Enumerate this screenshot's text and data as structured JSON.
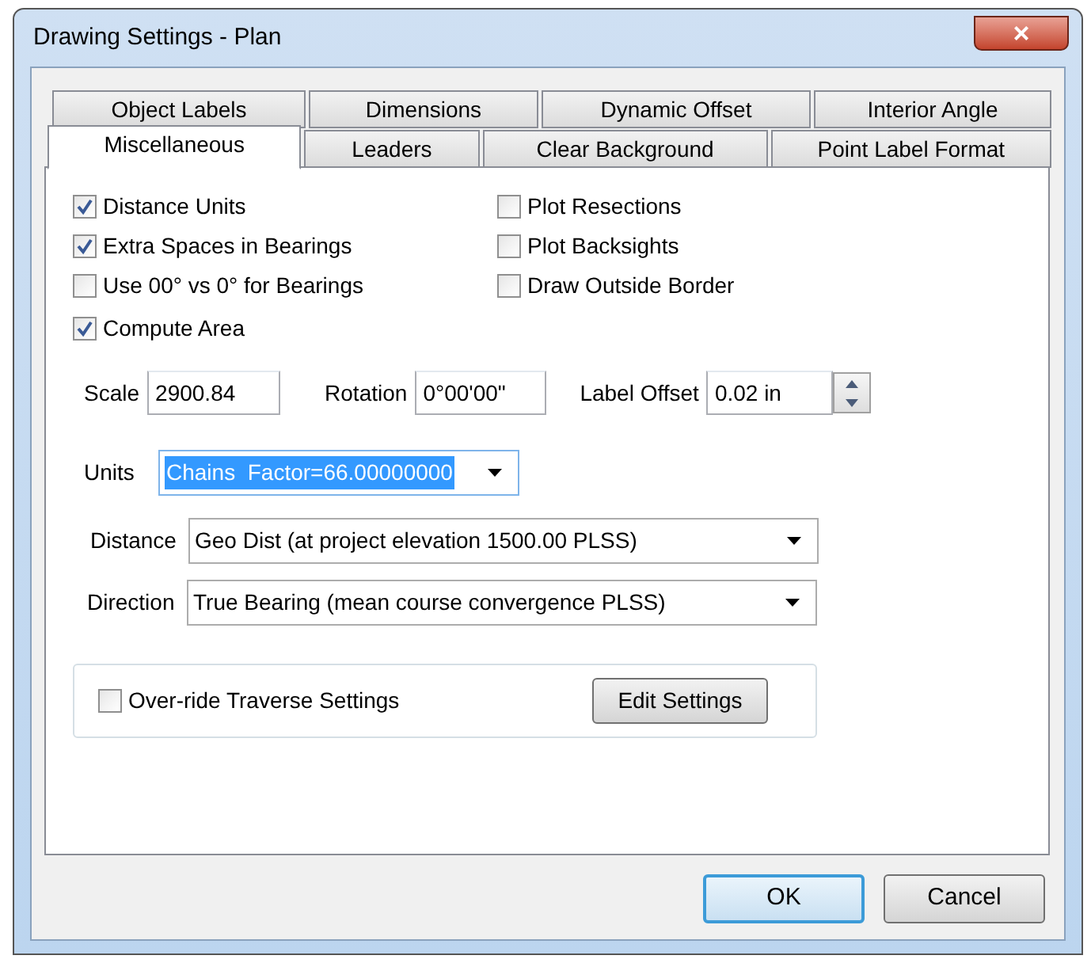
{
  "window": {
    "title": "Drawing Settings - Plan",
    "close": "×"
  },
  "tab_rows": [
    {
      "tabs": [
        {
          "label": "Object Labels",
          "selected": false
        },
        {
          "label": "Dimensions",
          "selected": false
        },
        {
          "label": "Dynamic Offset",
          "selected": false
        },
        {
          "label": "Interior Angle",
          "selected": false
        }
      ]
    },
    {
      "tabs": [
        {
          "label": "Miscellaneous",
          "selected": true
        },
        {
          "label": "Leaders",
          "selected": false
        },
        {
          "label": "Clear Background",
          "selected": false
        },
        {
          "label": "Point Label Format",
          "selected": false
        }
      ]
    }
  ],
  "checkbox_columns": [
    [
      {
        "label": "Distance Units",
        "checked": true
      },
      {
        "label": "Extra Spaces in Bearings",
        "checked": true
      },
      {
        "label": "Use 00° vs 0° for Bearings",
        "checked": false
      },
      {
        "label": "Compute Area",
        "checked": true
      }
    ],
    [
      {
        "label": "Plot Resections",
        "checked": false
      },
      {
        "label": "Plot Backsights",
        "checked": false
      },
      {
        "label": "Draw Outside Border",
        "checked": false
      }
    ]
  ],
  "fields": [
    {
      "label": "Scale",
      "value": "2900.84",
      "kind": "text"
    },
    {
      "label": "Rotation",
      "value": "0°00'00\"",
      "kind": "text"
    },
    {
      "label": "Label Offset",
      "value": "0.02 in",
      "kind": "spinner"
    }
  ],
  "dropdowns": [
    {
      "label": "Units",
      "value": "Chains  Factor=66.00000000",
      "highlighted": true
    },
    {
      "label": "Distance",
      "value": "Geo Dist (at project elevation 1500.00 PLSS)",
      "highlighted": false
    },
    {
      "label": "Direction",
      "value": "True Bearing (mean course convergence PLSS)",
      "highlighted": false
    }
  ],
  "traverse_group": {
    "checkbox": {
      "label": "Over-ride Traverse Settings",
      "checked": false
    },
    "button": "Edit Settings"
  },
  "buttons": [
    {
      "label": "OK",
      "default": true
    },
    {
      "label": "Cancel",
      "default": false
    }
  ]
}
